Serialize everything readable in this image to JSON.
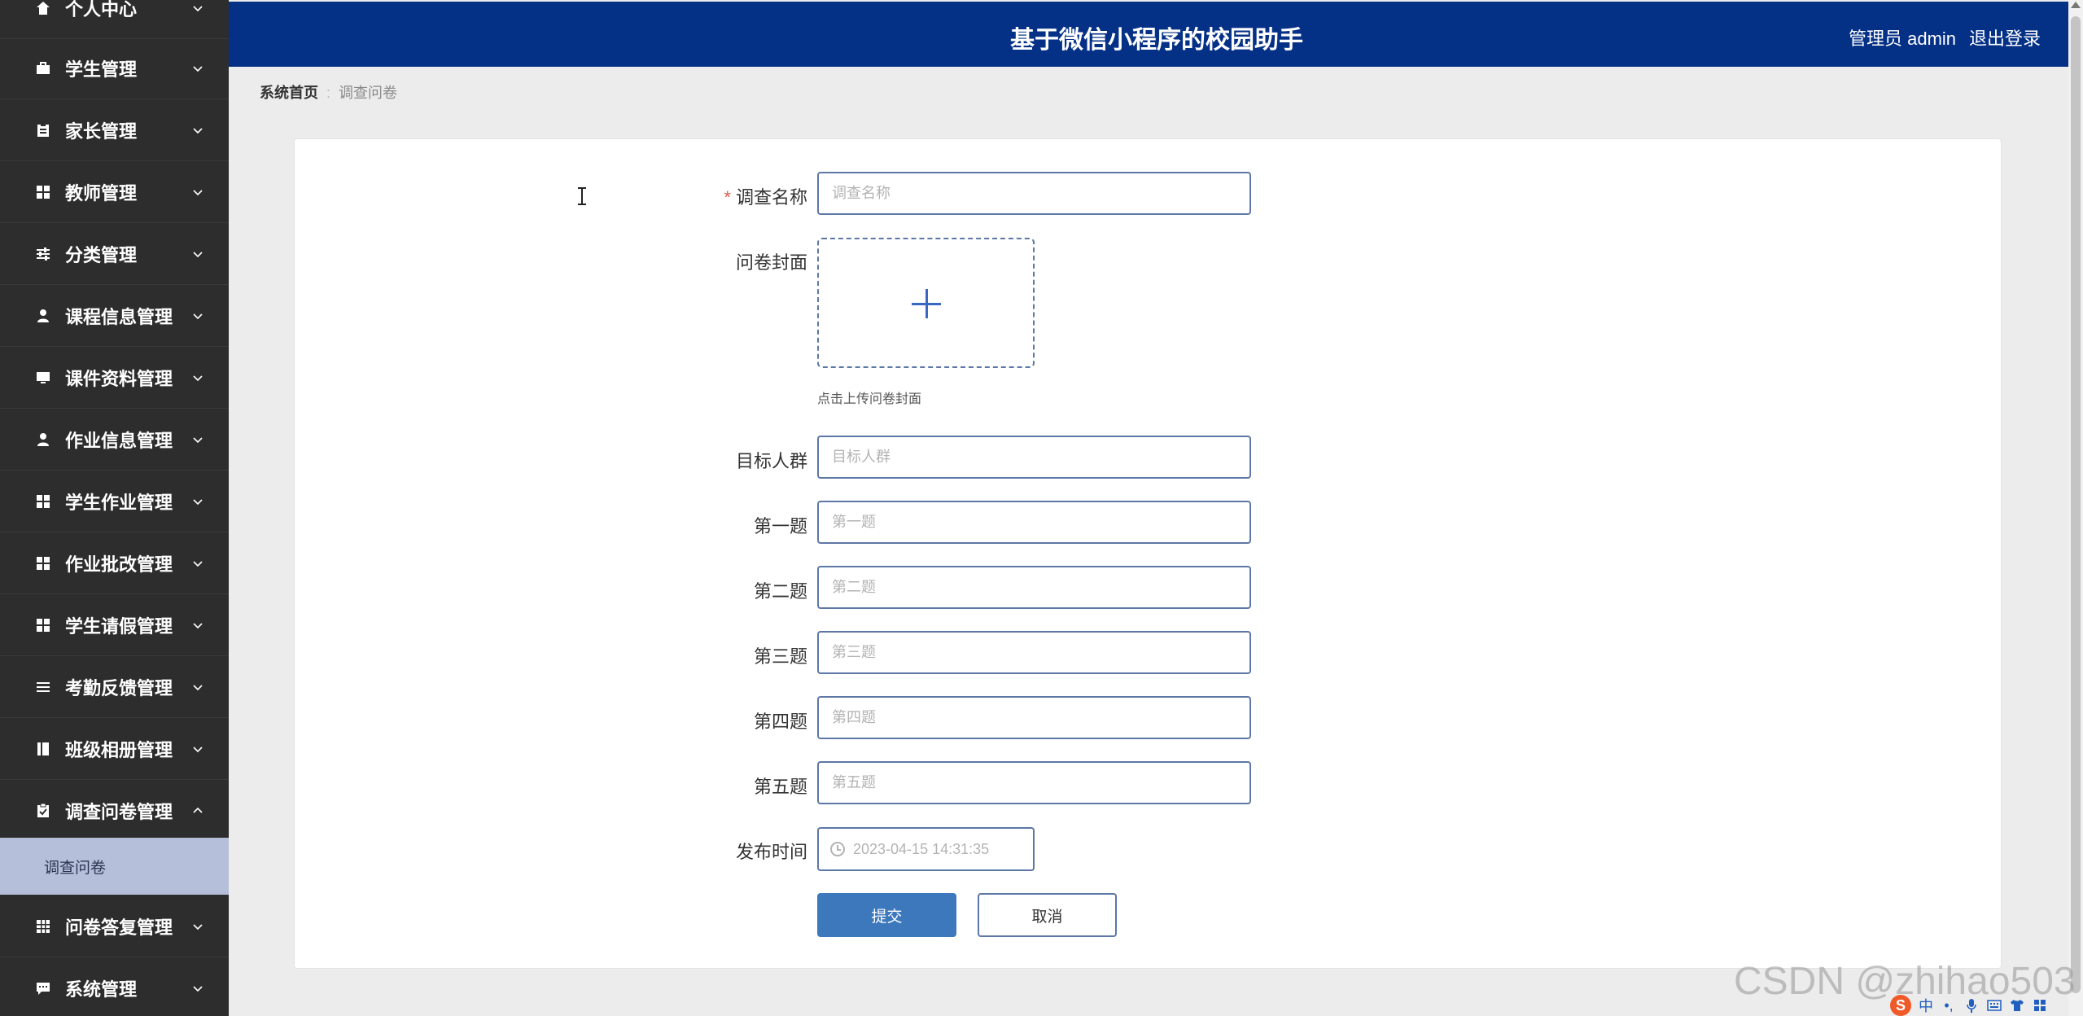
{
  "sidebar": {
    "items": [
      {
        "label": "个人中心",
        "icon": "house-icon",
        "expanded": false
      },
      {
        "label": "学生管理",
        "icon": "briefcase-icon",
        "expanded": false
      },
      {
        "label": "家长管理",
        "icon": "clipboard-icon",
        "expanded": false
      },
      {
        "label": "教师管理",
        "icon": "grid-icon",
        "expanded": false
      },
      {
        "label": "分类管理",
        "icon": "sliders-icon",
        "expanded": false
      },
      {
        "label": "课程信息管理",
        "icon": "user-icon",
        "expanded": false
      },
      {
        "label": "课件资料管理",
        "icon": "monitor-icon",
        "expanded": false
      },
      {
        "label": "作业信息管理",
        "icon": "user-icon",
        "expanded": false
      },
      {
        "label": "学生作业管理",
        "icon": "grid-icon",
        "expanded": false
      },
      {
        "label": "作业批改管理",
        "icon": "grid-icon",
        "expanded": false
      },
      {
        "label": "学生请假管理",
        "icon": "grid-icon",
        "expanded": false
      },
      {
        "label": "考勤反馈管理",
        "icon": "list-icon",
        "expanded": false
      },
      {
        "label": "班级相册管理",
        "icon": "book-icon",
        "expanded": false
      },
      {
        "label": "调查问卷管理",
        "icon": "clipboard-check-icon",
        "expanded": true
      },
      {
        "label": "问卷答复管理",
        "icon": "table-icon",
        "expanded": false
      },
      {
        "label": "系统管理",
        "icon": "chat-icon",
        "expanded": false
      }
    ],
    "submenu": {
      "label": "调查问卷"
    }
  },
  "header": {
    "title": "基于微信小程序的校园助手",
    "user": "管理员 admin",
    "logout": "退出登录"
  },
  "breadcrumb": {
    "home": "系统首页",
    "current": "调查问卷"
  },
  "form": {
    "name": {
      "label": "调查名称",
      "placeholder": "调查名称",
      "value": ""
    },
    "cover": {
      "label": "问卷封面",
      "hint": "点击上传问卷封面"
    },
    "target": {
      "label": "目标人群",
      "placeholder": "目标人群"
    },
    "q1": {
      "label": "第一题",
      "placeholder": "第一题"
    },
    "q2": {
      "label": "第二题",
      "placeholder": "第二题"
    },
    "q3": {
      "label": "第三题",
      "placeholder": "第三题"
    },
    "q4": {
      "label": "第四题",
      "placeholder": "第四题"
    },
    "q5": {
      "label": "第五题",
      "placeholder": "第五题"
    },
    "publish": {
      "label": "发布时间",
      "value": "2023-04-15 14:31:35"
    },
    "submit": "提交",
    "cancel": "取消"
  },
  "watermark": "CSDN @zhihao503",
  "tray": {
    "ime": "S",
    "lang": "中"
  },
  "colors": {
    "sidebar": "#2d2d2d",
    "header": "#043086",
    "submenu_active": "#b6bfd9",
    "primary_button": "#3d78bd",
    "input_border": "#5d77a6",
    "required": "#e25a4f"
  }
}
